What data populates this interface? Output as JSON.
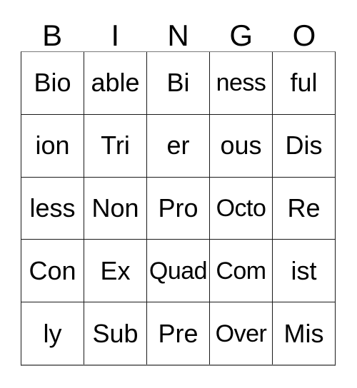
{
  "card": {
    "title": "BINGO",
    "header_letters": [
      "B",
      "I",
      "N",
      "G",
      "O"
    ],
    "grid_size": "5x5",
    "text_color": "#000000",
    "border_color": "#1a1a1a",
    "background_color": "#ffffff",
    "rows": [
      {
        "cells": [
          "Bio",
          "able",
          "Bi",
          "ness",
          "ful"
        ]
      },
      {
        "cells": [
          "ion",
          "Tri",
          "er",
          "ous",
          "Dis"
        ]
      },
      {
        "cells": [
          "less",
          "Non",
          "Pro",
          "Octo",
          "Re"
        ]
      },
      {
        "cells": [
          "Con",
          "Ex",
          "Quad",
          "Com",
          "ist"
        ]
      },
      {
        "cells": [
          "ly",
          "Sub",
          "Pre",
          "Over",
          "Mis"
        ]
      }
    ]
  }
}
